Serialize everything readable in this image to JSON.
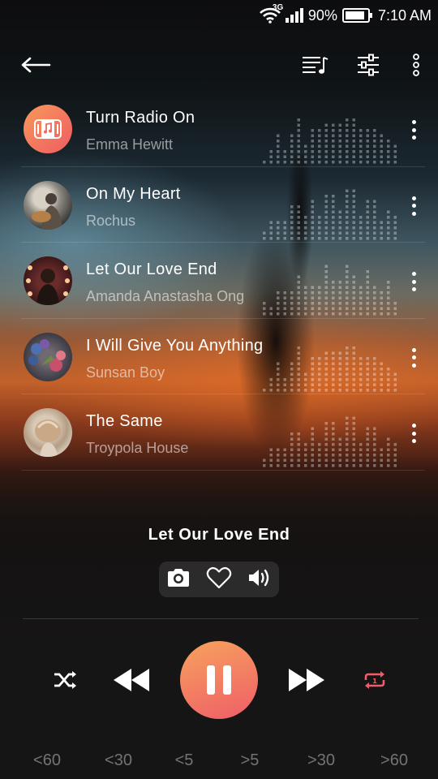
{
  "status_bar": {
    "network": "3G",
    "battery": "90%",
    "battery_level": 0.9,
    "time": "7:10 AM"
  },
  "app_bar": {
    "back_icon": "arrow-left-icon",
    "playlist_icon": "playlist-music-icon",
    "equalizer_icon": "sliders-icon",
    "menu_icon": "more-vertical-icon"
  },
  "tracks": [
    {
      "title": "Turn Radio On",
      "artist": "Emma Hewitt"
    },
    {
      "title": "On My Heart",
      "artist": "Rochus"
    },
    {
      "title": "Let Our Love End",
      "artist": "Amanda Anastasha Ong"
    },
    {
      "title": "I Will Give You Anything",
      "artist": "Sunsan Boy"
    },
    {
      "title": "The Same",
      "artist": "Troypola House"
    }
  ],
  "now_playing": {
    "title": "Let Our Love End",
    "actions": [
      "camera-icon",
      "heart-icon",
      "volume-icon"
    ]
  },
  "controls": {
    "shuffle": "shuffle-icon",
    "previous": "rewind-icon",
    "play_pause": "pause-icon",
    "next": "fast-forward-icon",
    "repeat": "repeat-one-icon"
  },
  "speeds": [
    "<60",
    "<30",
    "<5",
    ">5",
    ">30",
    ">60"
  ],
  "colors": {
    "accent_start": "#f7a35d",
    "accent_end": "#ef5d68",
    "repeat_active": "#ef5d68"
  }
}
